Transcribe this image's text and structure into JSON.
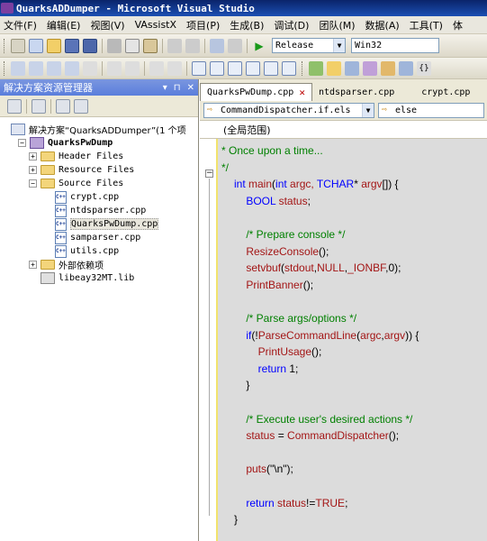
{
  "window": {
    "title": "QuarksADDumper - Microsoft Visual Studio"
  },
  "menu": [
    "文件(F)",
    "编辑(E)",
    "视图(V)",
    "VAssistX",
    "项目(P)",
    "生成(B)",
    "调试(D)",
    "团队(M)",
    "数据(A)",
    "工具(T)",
    "体"
  ],
  "toolbar": {
    "configuration": "Release",
    "platform": "Win32"
  },
  "explorer": {
    "title": "解决方案资源管理器",
    "header_buttons": [
      "▾",
      "⊓",
      "✕"
    ],
    "tree": [
      {
        "label": "解决方案“QuarksADDumper”(1 个项",
        "kind": "solution"
      },
      {
        "label": "QuarksPwDump",
        "kind": "project"
      },
      {
        "label": "Header Files",
        "kind": "folder"
      },
      {
        "label": "Resource Files",
        "kind": "folder"
      },
      {
        "label": "Source Files",
        "kind": "folder"
      },
      {
        "label": "crypt.cpp",
        "kind": "file"
      },
      {
        "label": "ntdsparser.cpp",
        "kind": "file"
      },
      {
        "label": "QuarksPwDump.cpp",
        "kind": "file",
        "selected": true
      },
      {
        "label": "samparser.cpp",
        "kind": "file"
      },
      {
        "label": "utils.cpp",
        "kind": "file"
      },
      {
        "label": "外部依赖项",
        "kind": "folder"
      },
      {
        "label": "libeay32MT.lib",
        "kind": "lib"
      }
    ]
  },
  "editor": {
    "tabs": [
      {
        "label": "QuarksPwDump.cpp",
        "active": true
      },
      {
        "label": "ntdsparser.cpp",
        "active": false
      },
      {
        "label": "crypt.cpp",
        "active": false
      }
    ],
    "close_glyph": "✕",
    "nav_left": "CommandDispatcher.if.els",
    "nav_right": "else",
    "scope": "(全局范围)",
    "code_lines": [
      [
        {
          "t": "* Once upon a time...",
          "c": "cm"
        }
      ],
      [
        {
          "t": "*/",
          "c": "cm"
        }
      ],
      [
        {
          "t": "int ",
          "c": "kw"
        },
        {
          "t": "main",
          "c": "fn"
        },
        {
          "t": "(",
          "c": "pl"
        },
        {
          "t": "int ",
          "c": "kw"
        },
        {
          "t": "argc, ",
          "c": "fn"
        },
        {
          "t": "TCHAR",
          "c": "kw"
        },
        {
          "t": "* ",
          "c": "pl"
        },
        {
          "t": "argv",
          "c": "fn"
        },
        {
          "t": "[]) {",
          "c": "pl"
        }
      ],
      [
        {
          "t": "    BOOL ",
          "c": "kw"
        },
        {
          "t": "status",
          "c": "fn"
        },
        {
          "t": ";",
          "c": "pl"
        }
      ],
      [
        {
          "t": "",
          "c": "pl"
        }
      ],
      [
        {
          "t": "    /* Prepare console */",
          "c": "cm"
        }
      ],
      [
        {
          "t": "    ResizeConsole",
          "c": "fn"
        },
        {
          "t": "();",
          "c": "pl"
        }
      ],
      [
        {
          "t": "    setvbuf",
          "c": "fn"
        },
        {
          "t": "(",
          "c": "pl"
        },
        {
          "t": "stdout",
          "c": "fn"
        },
        {
          "t": ",",
          "c": "pl"
        },
        {
          "t": "NULL",
          "c": "fn"
        },
        {
          "t": ",",
          "c": "pl"
        },
        {
          "t": "_IONBF",
          "c": "fn"
        },
        {
          "t": ",0);",
          "c": "pl"
        }
      ],
      [
        {
          "t": "    PrintBanner",
          "c": "fn"
        },
        {
          "t": "();",
          "c": "pl"
        }
      ],
      [
        {
          "t": "",
          "c": "pl"
        }
      ],
      [
        {
          "t": "    /* Parse args/options */",
          "c": "cm"
        }
      ],
      [
        {
          "t": "    if",
          "c": "kw"
        },
        {
          "t": "(!",
          "c": "pl"
        },
        {
          "t": "ParseCommandLine",
          "c": "fn"
        },
        {
          "t": "(",
          "c": "pl"
        },
        {
          "t": "argc",
          "c": "fn"
        },
        {
          "t": ",",
          "c": "pl"
        },
        {
          "t": "argv",
          "c": "fn"
        },
        {
          "t": ")) {",
          "c": "pl"
        }
      ],
      [
        {
          "t": "        PrintUsage",
          "c": "fn"
        },
        {
          "t": "();",
          "c": "pl"
        }
      ],
      [
        {
          "t": "        return ",
          "c": "kw"
        },
        {
          "t": "1;",
          "c": "pl"
        }
      ],
      [
        {
          "t": "    }",
          "c": "pl"
        }
      ],
      [
        {
          "t": "",
          "c": "pl"
        }
      ],
      [
        {
          "t": "    /* Execute user's desired actions */",
          "c": "cm"
        }
      ],
      [
        {
          "t": "    status ",
          "c": "fn"
        },
        {
          "t": "= ",
          "c": "pl"
        },
        {
          "t": "CommandDispatcher",
          "c": "fn"
        },
        {
          "t": "();",
          "c": "pl"
        }
      ],
      [
        {
          "t": "",
          "c": "pl"
        }
      ],
      [
        {
          "t": "    puts",
          "c": "fn"
        },
        {
          "t": "(\"\\n\");",
          "c": "pl"
        }
      ],
      [
        {
          "t": "",
          "c": "pl"
        }
      ],
      [
        {
          "t": "    return ",
          "c": "kw"
        },
        {
          "t": "status",
          "c": "fn"
        },
        {
          "t": "!=",
          "c": "pl"
        },
        {
          "t": "TRUE",
          "c": "fn"
        },
        {
          "t": ";",
          "c": "pl"
        }
      ],
      [
        {
          "t": "}",
          "c": "pl"
        }
      ]
    ]
  }
}
